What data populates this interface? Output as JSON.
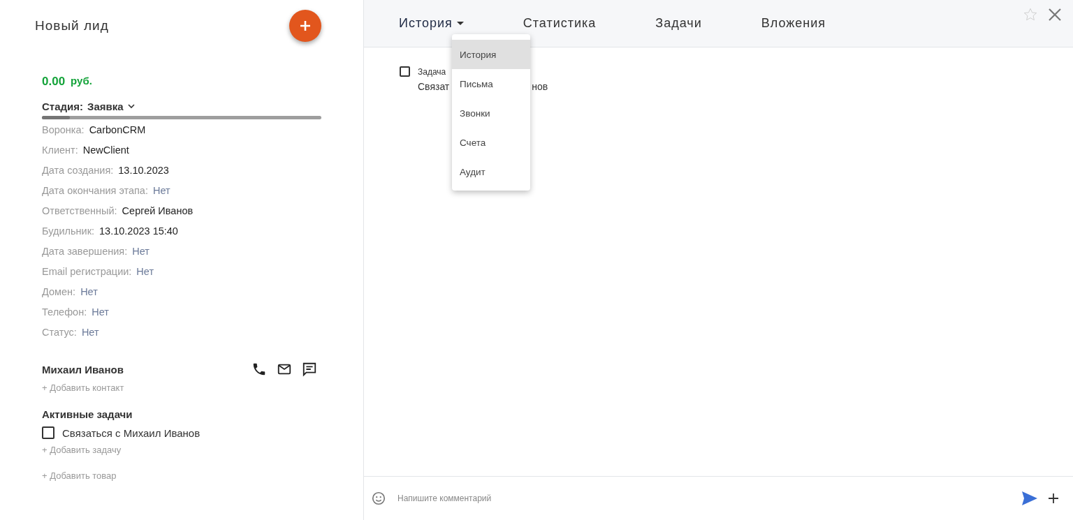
{
  "lead": {
    "title": "Новый лид",
    "amount": "0.00",
    "currency": "руб.",
    "stage_label": "Стадия:",
    "stage_value": "Заявка",
    "progress": {
      "level": 0.1
    }
  },
  "fields": [
    {
      "label": "Воронка:",
      "value": "CarbonCRM",
      "empty": false
    },
    {
      "label": "Клиент:",
      "value": "NewClient",
      "empty": false
    },
    {
      "label": "Дата создания:",
      "value": "13.10.2023",
      "empty": false
    },
    {
      "label": "Дата окончания этапа:",
      "value": "Нет",
      "empty": true
    },
    {
      "label": "Ответственный:",
      "value": "Сергей Иванов",
      "empty": false
    },
    {
      "label": "Будильник:",
      "value": "13.10.2023 15:40",
      "empty": false
    },
    {
      "label": "Дата завершения:",
      "value": "Нет",
      "empty": true
    },
    {
      "label": "Email регистрации:",
      "value": "Нет",
      "empty": true
    },
    {
      "label": "Домен:",
      "value": "Нет",
      "empty": true
    },
    {
      "label": "Телефон:",
      "value": "Нет",
      "empty": true
    },
    {
      "label": "Статус:",
      "value": "Нет",
      "empty": true
    }
  ],
  "contact": {
    "name": "Михаил Иванов",
    "add_link": "+ Добавить контакт"
  },
  "active_tasks": {
    "title": "Активные задачи",
    "items": [
      {
        "text": "Связаться с Михаил Иванов",
        "checked": false
      }
    ],
    "add_link": "+ Добавить задачу"
  },
  "add_product": "+ Добавить товар",
  "tabs": [
    {
      "label": "История",
      "selected": true,
      "dropdown": true
    },
    {
      "label": "Статистика",
      "selected": false,
      "dropdown": false
    },
    {
      "label": "Задачи",
      "selected": false,
      "dropdown": false
    },
    {
      "label": "Вложения",
      "selected": false,
      "dropdown": false
    }
  ],
  "menu": [
    {
      "label": "История",
      "selected": true
    },
    {
      "label": "Письма",
      "selected": false
    },
    {
      "label": "Звонки",
      "selected": false
    },
    {
      "label": "Счета",
      "selected": false
    },
    {
      "label": "Аудит",
      "selected": false
    }
  ],
  "history": [
    {
      "checked": false,
      "title": "Задача",
      "text_start": "Связат",
      "text_end": "нов"
    }
  ],
  "comment": {
    "placeholder": "Напишите комментарий"
  }
}
